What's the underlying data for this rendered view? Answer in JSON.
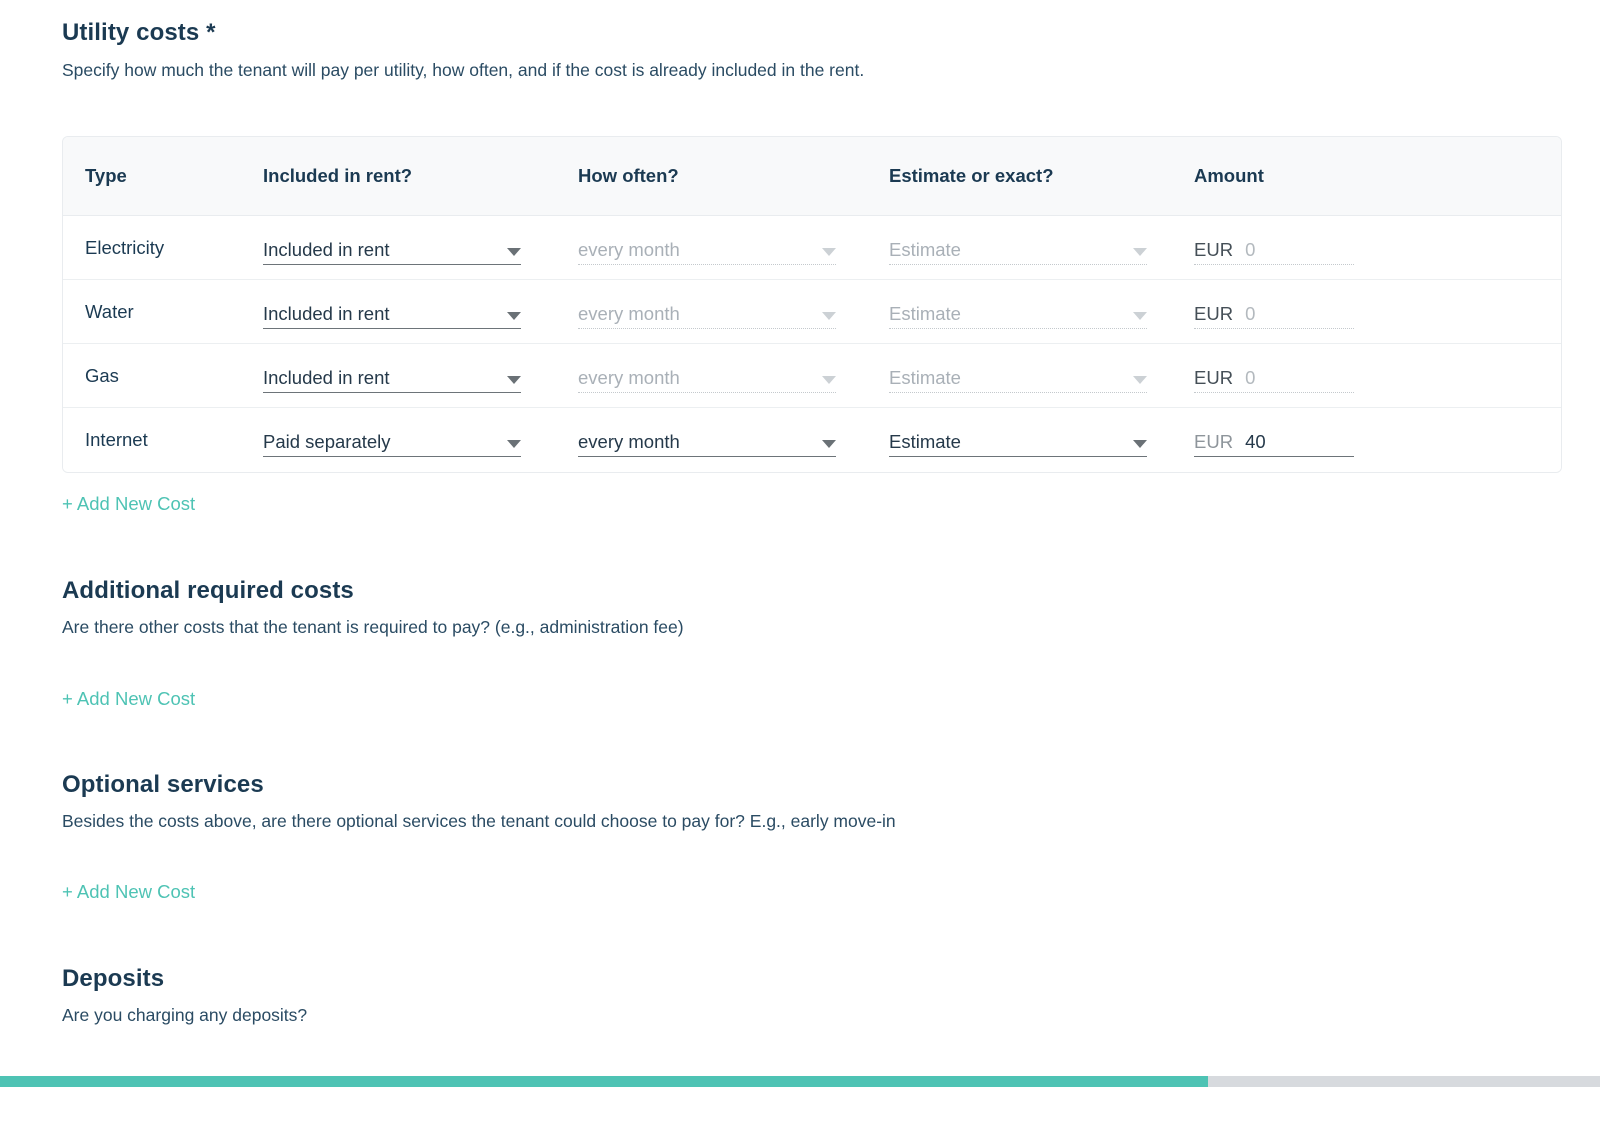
{
  "utility": {
    "title": "Utility costs *",
    "subtitle": "Specify how much the tenant will pay per utility, how often, and if the cost is already included in the rent.",
    "table": {
      "headers": [
        "Type",
        "Included in rent?",
        "How often?",
        "Estimate or exact?",
        "Amount"
      ],
      "rows": [
        {
          "type": "Electricity",
          "included": "Included in rent",
          "how_often": "every month",
          "estimate": "Estimate",
          "currency": "EUR",
          "amount": "0"
        },
        {
          "type": "Water",
          "included": "Included in rent",
          "how_often": "every month",
          "estimate": "Estimate",
          "currency": "EUR",
          "amount": "0"
        },
        {
          "type": "Gas",
          "included": "Included in rent",
          "how_often": "every month",
          "estimate": "Estimate",
          "currency": "EUR",
          "amount": "0"
        },
        {
          "type": "Internet",
          "included": "Paid separately",
          "how_often": "every month",
          "estimate": "Estimate",
          "currency": "EUR",
          "amount": "40"
        }
      ]
    },
    "add_link": "+ Add New Cost"
  },
  "additional": {
    "title": "Additional required costs",
    "subtitle": "Are there other costs that the tenant is required to pay? (e.g., administration fee)",
    "add_link": "+ Add New Cost"
  },
  "optional": {
    "title": "Optional services",
    "subtitle": "Besides the costs above, are there optional services the tenant could choose to pay for? E.g., early move-in",
    "add_link": "+ Add New Cost"
  },
  "deposits": {
    "title": "Deposits",
    "subtitle": "Are you charging any deposits?"
  },
  "progress": {
    "percent": 75.5,
    "fill_color": "#4ec3b4",
    "track_color": "#d7dade"
  },
  "colors": {
    "heading": "#1b3a52",
    "body": "#2a4b63",
    "accent": "#4ec3b4",
    "muted": "#a9b0b7"
  }
}
